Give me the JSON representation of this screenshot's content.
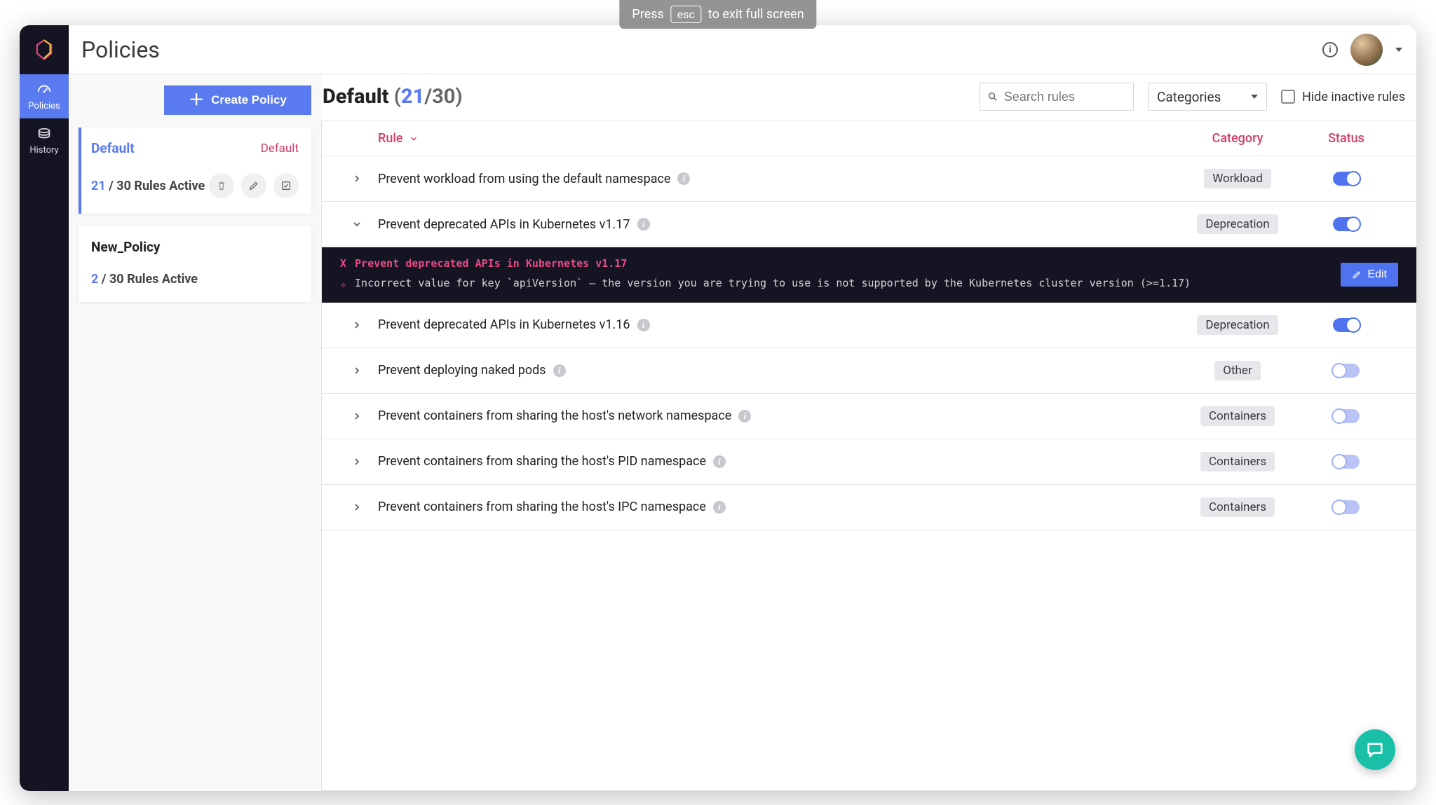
{
  "esc_hint": {
    "before": "Press",
    "key": "esc",
    "after": "to exit full screen"
  },
  "header": {
    "title": "Policies"
  },
  "nav": {
    "policies": "Policies",
    "history": "History"
  },
  "create_button": "Create Policy",
  "policies": [
    {
      "name": "Default",
      "badge": "Default",
      "active_count": "21",
      "rules_text": " / 30 Rules Active",
      "selected": true
    },
    {
      "name": "New_Policy",
      "badge": "",
      "active_count": "2",
      "rules_text": " / 30 Rules Active",
      "selected": false
    }
  ],
  "breadcrumb": {
    "name": "Default",
    "active": "21",
    "total": "30"
  },
  "search": {
    "placeholder": "Search rules"
  },
  "categories_dropdown": "Categories",
  "hide_inactive": "Hide inactive rules",
  "table": {
    "headers": {
      "rule": "Rule",
      "category": "Category",
      "status": "Status"
    },
    "rows": [
      {
        "name": "Prevent workload from using the default namespace",
        "category": "Workload",
        "active": true,
        "expanded": false
      },
      {
        "name": "Prevent deprecated APIs in Kubernetes v1.17",
        "category": "Deprecation",
        "active": true,
        "expanded": true
      },
      {
        "name": "Prevent deprecated APIs in Kubernetes v1.16",
        "category": "Deprecation",
        "active": true,
        "expanded": false
      },
      {
        "name": "Prevent deploying naked pods",
        "category": "Other",
        "active": false,
        "expanded": false
      },
      {
        "name": "Prevent containers from sharing the host's network namespace",
        "category": "Containers",
        "active": false,
        "expanded": false
      },
      {
        "name": "Prevent containers from sharing the host's PID namespace",
        "category": "Containers",
        "active": false,
        "expanded": false
      },
      {
        "name": "Prevent containers from sharing the host's IPC namespace",
        "category": "Containers",
        "active": false,
        "expanded": false
      }
    ]
  },
  "detail": {
    "title": "Prevent deprecated APIs in Kubernetes v1.17",
    "message": "Incorrect value for key `apiVersion` – the version you are trying to use is not supported by the Kubernetes cluster version (>=1.17)",
    "edit": "Edit"
  }
}
